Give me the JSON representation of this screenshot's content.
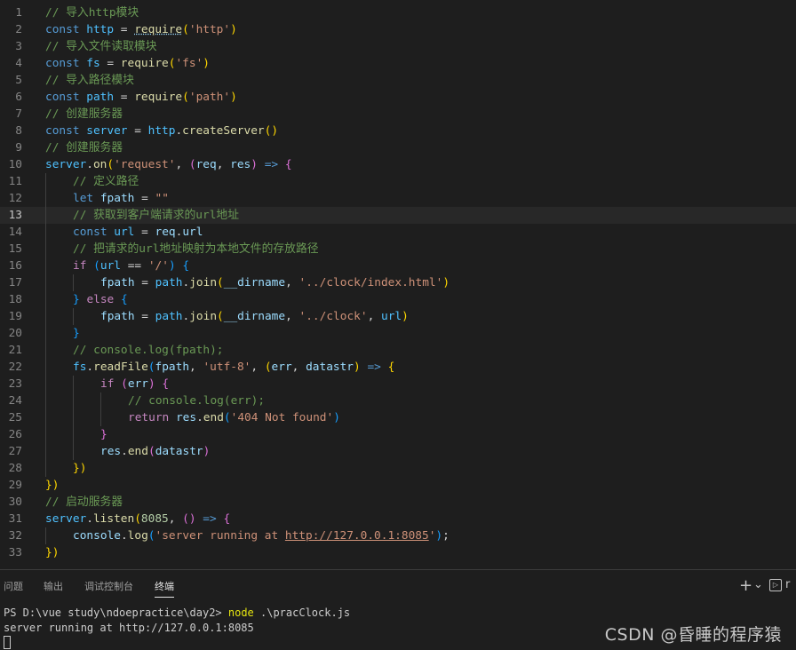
{
  "editor": {
    "current_line": 13,
    "lines": [
      {
        "n": 1,
        "indent": 0,
        "tokens": [
          [
            "// 导入http模块",
            "comment"
          ]
        ]
      },
      {
        "n": 2,
        "indent": 0,
        "tokens": [
          [
            "const",
            "kw"
          ],
          [
            " ",
            "punc"
          ],
          [
            "http",
            "const"
          ],
          [
            " = ",
            "punc"
          ],
          [
            "require",
            "req"
          ],
          [
            "(",
            "b1"
          ],
          [
            "'http'",
            "str"
          ],
          [
            ")",
            "b1"
          ]
        ]
      },
      {
        "n": 3,
        "indent": 0,
        "tokens": [
          [
            "// 导入文件读取模块",
            "comment"
          ]
        ]
      },
      {
        "n": 4,
        "indent": 0,
        "tokens": [
          [
            "const",
            "kw"
          ],
          [
            " ",
            "punc"
          ],
          [
            "fs",
            "const"
          ],
          [
            " = ",
            "punc"
          ],
          [
            "require",
            "fn"
          ],
          [
            "(",
            "b1"
          ],
          [
            "'fs'",
            "str"
          ],
          [
            ")",
            "b1"
          ]
        ]
      },
      {
        "n": 5,
        "indent": 0,
        "tokens": [
          [
            "// 导入路径模块",
            "comment"
          ]
        ]
      },
      {
        "n": 6,
        "indent": 0,
        "tokens": [
          [
            "const",
            "kw"
          ],
          [
            " ",
            "punc"
          ],
          [
            "path",
            "const"
          ],
          [
            " = ",
            "punc"
          ],
          [
            "require",
            "fn"
          ],
          [
            "(",
            "b1"
          ],
          [
            "'path'",
            "str"
          ],
          [
            ")",
            "b1"
          ]
        ]
      },
      {
        "n": 7,
        "indent": 0,
        "tokens": [
          [
            "// 创建服务器",
            "comment"
          ]
        ]
      },
      {
        "n": 8,
        "indent": 0,
        "tokens": [
          [
            "const",
            "kw"
          ],
          [
            " ",
            "punc"
          ],
          [
            "server",
            "const"
          ],
          [
            " = ",
            "punc"
          ],
          [
            "http",
            "const"
          ],
          [
            ".",
            "punc"
          ],
          [
            "createServer",
            "fn"
          ],
          [
            "()",
            "b1"
          ]
        ]
      },
      {
        "n": 9,
        "indent": 0,
        "tokens": [
          [
            "// 创建服务器",
            "comment"
          ]
        ]
      },
      {
        "n": 10,
        "indent": 0,
        "tokens": [
          [
            "server",
            "const"
          ],
          [
            ".",
            "punc"
          ],
          [
            "on",
            "fn"
          ],
          [
            "(",
            "b1"
          ],
          [
            "'request'",
            "str"
          ],
          [
            ", ",
            "punc"
          ],
          [
            "(",
            "b2"
          ],
          [
            "req",
            "var"
          ],
          [
            ", ",
            "punc"
          ],
          [
            "res",
            "var"
          ],
          [
            ")",
            "b2"
          ],
          [
            " ",
            "punc"
          ],
          [
            "=>",
            "kw"
          ],
          [
            " ",
            "punc"
          ],
          [
            "{",
            "b2"
          ]
        ]
      },
      {
        "n": 11,
        "indent": 1,
        "tokens": [
          [
            "// 定义路径",
            "comment"
          ]
        ]
      },
      {
        "n": 12,
        "indent": 1,
        "tokens": [
          [
            "let",
            "kw"
          ],
          [
            " ",
            "punc"
          ],
          [
            "fpath",
            "var"
          ],
          [
            " = ",
            "punc"
          ],
          [
            "\"\"",
            "str"
          ]
        ]
      },
      {
        "n": 13,
        "indent": 1,
        "tokens": [
          [
            "// 获取到客户端请求的url地址",
            "comment"
          ]
        ]
      },
      {
        "n": 14,
        "indent": 1,
        "tokens": [
          [
            "const",
            "kw"
          ],
          [
            " ",
            "punc"
          ],
          [
            "url",
            "const"
          ],
          [
            " = ",
            "punc"
          ],
          [
            "req",
            "var"
          ],
          [
            ".",
            "punc"
          ],
          [
            "url",
            "var"
          ]
        ]
      },
      {
        "n": 15,
        "indent": 1,
        "tokens": [
          [
            "// 把请求的url地址映射为本地文件的存放路径",
            "comment"
          ]
        ]
      },
      {
        "n": 16,
        "indent": 1,
        "tokens": [
          [
            "if",
            "ctrl"
          ],
          [
            " ",
            "punc"
          ],
          [
            "(",
            "b3"
          ],
          [
            "url",
            "const"
          ],
          [
            " == ",
            "punc"
          ],
          [
            "'/'",
            "str"
          ],
          [
            ")",
            "b3"
          ],
          [
            " ",
            "punc"
          ],
          [
            "{",
            "b3"
          ]
        ]
      },
      {
        "n": 17,
        "indent": 2,
        "tokens": [
          [
            "fpath",
            "var"
          ],
          [
            " = ",
            "punc"
          ],
          [
            "path",
            "const"
          ],
          [
            ".",
            "punc"
          ],
          [
            "join",
            "fn"
          ],
          [
            "(",
            "b1"
          ],
          [
            "__dirname",
            "var"
          ],
          [
            ", ",
            "punc"
          ],
          [
            "'../clock/index.html'",
            "str"
          ],
          [
            ")",
            "b1"
          ]
        ]
      },
      {
        "n": 18,
        "indent": 1,
        "tokens": [
          [
            "}",
            "b3"
          ],
          [
            " ",
            "punc"
          ],
          [
            "else",
            "ctrl"
          ],
          [
            " ",
            "punc"
          ],
          [
            "{",
            "b3"
          ]
        ]
      },
      {
        "n": 19,
        "indent": 2,
        "tokens": [
          [
            "fpath",
            "var"
          ],
          [
            " = ",
            "punc"
          ],
          [
            "path",
            "const"
          ],
          [
            ".",
            "punc"
          ],
          [
            "join",
            "fn"
          ],
          [
            "(",
            "b1"
          ],
          [
            "__dirname",
            "var"
          ],
          [
            ", ",
            "punc"
          ],
          [
            "'../clock'",
            "str"
          ],
          [
            ", ",
            "punc"
          ],
          [
            "url",
            "const"
          ],
          [
            ")",
            "b1"
          ]
        ]
      },
      {
        "n": 20,
        "indent": 1,
        "tokens": [
          [
            "}",
            "b3"
          ]
        ]
      },
      {
        "n": 21,
        "indent": 1,
        "tokens": [
          [
            "// console.log(fpath);",
            "comment"
          ]
        ]
      },
      {
        "n": 22,
        "indent": 1,
        "tokens": [
          [
            "fs",
            "const"
          ],
          [
            ".",
            "punc"
          ],
          [
            "readFile",
            "fn"
          ],
          [
            "(",
            "b3"
          ],
          [
            "fpath",
            "var"
          ],
          [
            ", ",
            "punc"
          ],
          [
            "'utf-8'",
            "str"
          ],
          [
            ", ",
            "punc"
          ],
          [
            "(",
            "b1"
          ],
          [
            "err",
            "var"
          ],
          [
            ", ",
            "punc"
          ],
          [
            "datastr",
            "var"
          ],
          [
            ")",
            "b1"
          ],
          [
            " ",
            "punc"
          ],
          [
            "=>",
            "kw"
          ],
          [
            " ",
            "punc"
          ],
          [
            "{",
            "b1"
          ]
        ]
      },
      {
        "n": 23,
        "indent": 2,
        "tokens": [
          [
            "if",
            "ctrl"
          ],
          [
            " ",
            "punc"
          ],
          [
            "(",
            "b2"
          ],
          [
            "err",
            "var"
          ],
          [
            ")",
            "b2"
          ],
          [
            " ",
            "punc"
          ],
          [
            "{",
            "b2"
          ]
        ]
      },
      {
        "n": 24,
        "indent": 3,
        "tokens": [
          [
            "// console.log(err);",
            "comment"
          ]
        ]
      },
      {
        "n": 25,
        "indent": 3,
        "tokens": [
          [
            "return",
            "ctrl"
          ],
          [
            " ",
            "punc"
          ],
          [
            "res",
            "var"
          ],
          [
            ".",
            "punc"
          ],
          [
            "end",
            "fn"
          ],
          [
            "(",
            "b3"
          ],
          [
            "'404 Not found'",
            "str"
          ],
          [
            ")",
            "b3"
          ]
        ]
      },
      {
        "n": 26,
        "indent": 2,
        "tokens": [
          [
            "}",
            "b2"
          ]
        ]
      },
      {
        "n": 27,
        "indent": 2,
        "tokens": [
          [
            "res",
            "var"
          ],
          [
            ".",
            "punc"
          ],
          [
            "end",
            "fn"
          ],
          [
            "(",
            "b2"
          ],
          [
            "datastr",
            "var"
          ],
          [
            ")",
            "b2"
          ]
        ]
      },
      {
        "n": 28,
        "indent": 1,
        "tokens": [
          [
            "})",
            "b1"
          ]
        ]
      },
      {
        "n": 29,
        "indent": 0,
        "tokens": [
          [
            "})",
            "b1"
          ]
        ]
      },
      {
        "n": 30,
        "indent": 0,
        "tokens": [
          [
            "// 启动服务器",
            "comment"
          ]
        ]
      },
      {
        "n": 31,
        "indent": 0,
        "tokens": [
          [
            "server",
            "const"
          ],
          [
            ".",
            "punc"
          ],
          [
            "listen",
            "fn"
          ],
          [
            "(",
            "b1"
          ],
          [
            "8085",
            "num"
          ],
          [
            ", ",
            "punc"
          ],
          [
            "()",
            "b2"
          ],
          [
            " ",
            "punc"
          ],
          [
            "=>",
            "kw"
          ],
          [
            " ",
            "punc"
          ],
          [
            "{",
            "b2"
          ]
        ]
      },
      {
        "n": 32,
        "indent": 1,
        "tokens": [
          [
            "console",
            "var"
          ],
          [
            ".",
            "punc"
          ],
          [
            "log",
            "fn"
          ],
          [
            "(",
            "b3"
          ],
          [
            "'server running at ",
            "str"
          ],
          [
            "http://127.0.0.1:8085",
            "link"
          ],
          [
            "'",
            "str"
          ],
          [
            ")",
            "b3"
          ],
          [
            ";",
            "punc"
          ]
        ]
      },
      {
        "n": 33,
        "indent": 0,
        "tokens": [
          [
            "})",
            "b1"
          ]
        ]
      }
    ]
  },
  "panel": {
    "tabs": [
      {
        "id": "problems",
        "label": "问题"
      },
      {
        "id": "output",
        "label": "输出"
      },
      {
        "id": "debug-console",
        "label": "调试控制台"
      },
      {
        "id": "terminal",
        "label": "终端",
        "active": true
      }
    ],
    "actions": {
      "add": "+",
      "dropdown": "⌄",
      "terminal_icon": "▷",
      "overflow": "r"
    },
    "terminal": {
      "prompt": "PS D:\\vue study\\ndoepractice\\day2> ",
      "command": "node",
      "args": " .\\pracClock.js",
      "output": "server running at http://127.0.0.1:8085"
    }
  },
  "watermark": "CSDN @昏睡的程序猿"
}
